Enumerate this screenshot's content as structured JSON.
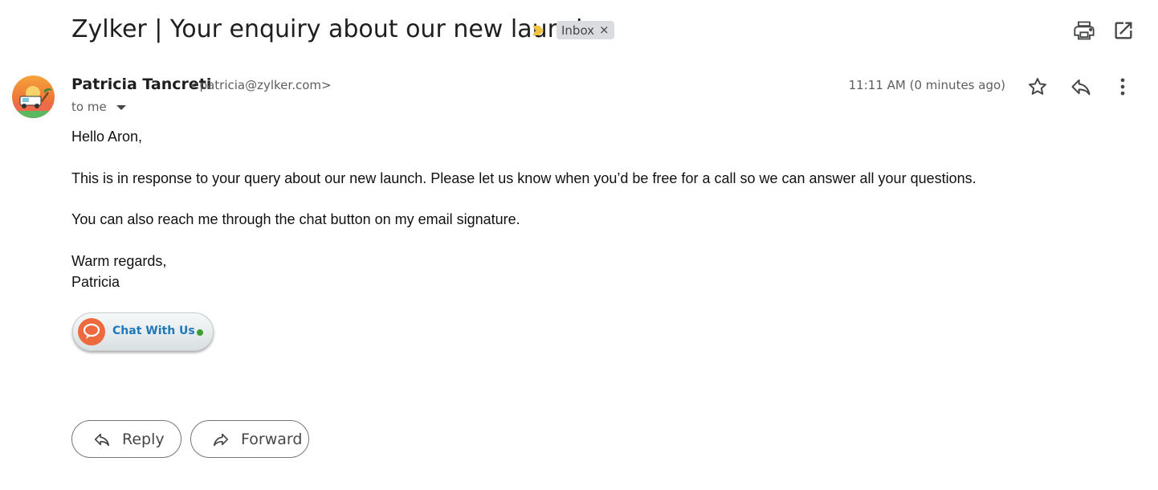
{
  "message": {
    "subject": "Zylker | Your enquiry about our new launch",
    "label": "Inbox",
    "label_remove_glyph": "×",
    "importance_color": "#f2c443",
    "sender": {
      "name": "Patricia Tancreti",
      "email": "<patricia@zylker.com>"
    },
    "recipient_text": "to me",
    "timestamp": "11:11 AM (0 minutes ago)"
  },
  "body": {
    "greeting": "Hello Aron,",
    "paragraph_1": "This is in response to your query about our new launch. Please let us know when you’d be free for a call so we can answer all your questions.",
    "paragraph_2": "You can also reach me through the chat button on my email signature.",
    "closing": "Warm regards,",
    "signature_name": "Patricia",
    "chat_button_label": "Chat With Us"
  },
  "actions": {
    "reply_label": "Reply",
    "forward_label": "Forward"
  },
  "icons": {
    "print": "print-icon",
    "open_new_window": "open-in-new-icon",
    "star": "star-icon",
    "reply": "reply-icon",
    "more": "more-vert-icon",
    "importance": "importance-marker-icon",
    "chat": "chat-bubble-icon"
  },
  "colors": {
    "chat_accent": "#ec6a3d",
    "chat_text": "#1f79b8",
    "online_status": "#3f9e2f"
  }
}
